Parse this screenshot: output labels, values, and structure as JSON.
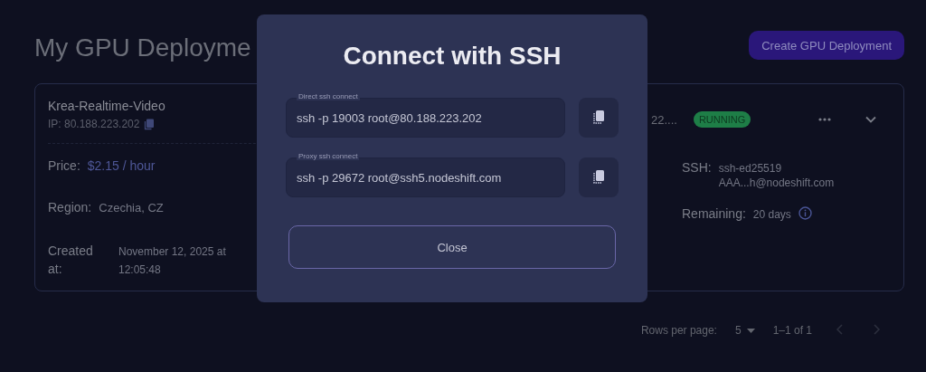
{
  "page": {
    "title": "My GPU Deployme",
    "create_button": "Create GPU Deployment"
  },
  "deployment": {
    "name": "Krea-Realtime-Video",
    "ip": "IP: 80.188.223.202",
    "image_partial": "22....",
    "status": "RUNNING",
    "fields": [
      {
        "label": "Price:",
        "value": "$2.15 / hour",
        "kind": "price"
      },
      {
        "label": "Region:",
        "value": "Czechia, CZ",
        "kind": "plain"
      },
      {
        "label": "Created at:",
        "value": "November 12, 2025 at 12:05:48",
        "kind": "plain"
      }
    ],
    "right_fields": [
      {
        "label": "SSH:",
        "value": "ssh-ed25519 AAA...h@nodeshift.com",
        "kind": "plain"
      },
      {
        "label": "Remaining:",
        "value": "20 days",
        "kind": "info"
      }
    ]
  },
  "pagination": {
    "rows_label": "Rows per page:",
    "rows_value": "5",
    "range": "1–1 of 1",
    "prev": {
      "disabled": true
    },
    "next": {
      "disabled": true
    }
  },
  "dialog": {
    "title": "Connect with SSH",
    "commands": [
      {
        "label": "Direct ssh connect",
        "value": "ssh -p 19003 root@80.188.223.202"
      },
      {
        "label": "Proxy ssh connect",
        "value": "ssh -p 29672 root@ssh5.nodeshift.com"
      }
    ],
    "close_button": "Close"
  }
}
